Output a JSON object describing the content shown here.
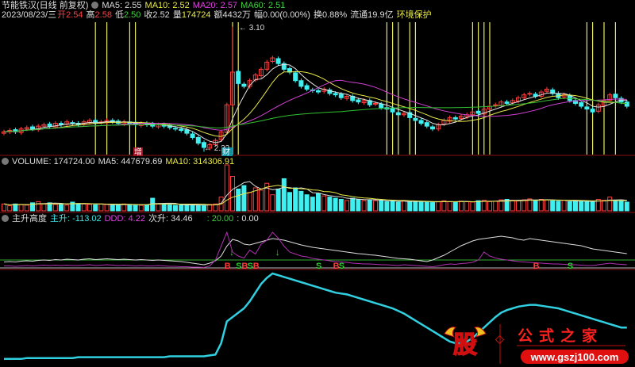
{
  "header": {
    "title": "节能铁汉(日线 前复权)",
    "ma5": "MA5: 2.55",
    "ma10": "MA10: 2.52",
    "ma20": "MA20: 2.57",
    "ma60": "MA60: 2.51",
    "date": "2023/08/23/三",
    "open_l": "开",
    "open": "2.54",
    "high_l": "高",
    "high": "2.58",
    "low_l": "低",
    "low": "2.50",
    "close": "收2.52",
    "vol_l": "量",
    "vol": "174724",
    "amount": "额4432万",
    "change": "幅0.00(0.00%)",
    "turnover": "换0.88%",
    "float": "流通19.9亿",
    "concept": "环境保护"
  },
  "volume_header": {
    "volume": "VOLUME: 174724.00",
    "ma5": "MA5: 447679.69",
    "ma10": "MA10: 314306.91"
  },
  "indicator_header": {
    "name": "主升高度",
    "zs": "主升: -113.02",
    "ddd": "DDD: 4.22",
    "cs": "次升: 34.46",
    "l20": ": 20.00",
    "l0": ": 0.00"
  },
  "labels": {
    "max": "3.10",
    "min": "2.22",
    "zeng": "增",
    "cai": "财"
  },
  "logo": {
    "char": "股",
    "name": "公式之家",
    "url": "www.gszj100.com"
  },
  "colors": {
    "up": "#ff3c3c",
    "down": "#40f0f0",
    "ma5": "#e0e0e0",
    "ma10": "#e8e84a",
    "ma20": "#d040d0",
    "ma60": "#30c030",
    "signal": "#e8e860"
  },
  "chart_data": {
    "type": "candlestick",
    "price_range": [
      2.2,
      3.12
    ],
    "closes": [
      2.36,
      2.37,
      2.36,
      2.38,
      2.39,
      2.38,
      2.4,
      2.41,
      2.4,
      2.42,
      2.41,
      2.43,
      2.42,
      2.41,
      2.43,
      2.44,
      2.42,
      2.43,
      2.44,
      2.43,
      2.42,
      2.43,
      2.42,
      2.41,
      2.42,
      2.41,
      2.4,
      2.41,
      2.4,
      2.39,
      2.38,
      2.37,
      2.35,
      2.32,
      2.28,
      2.25,
      2.27,
      2.3,
      2.36,
      2.55,
      2.78,
      2.7,
      2.68,
      2.72,
      2.76,
      2.8,
      2.85,
      2.88,
      2.84,
      2.8,
      2.78,
      2.72,
      2.68,
      2.66,
      2.65,
      2.64,
      2.66,
      2.63,
      2.62,
      2.6,
      2.61,
      2.58,
      2.57,
      2.58,
      2.55,
      2.56,
      2.53,
      2.52,
      2.5,
      2.48,
      2.49,
      2.46,
      2.44,
      2.42,
      2.4,
      2.38,
      2.41,
      2.44,
      2.46,
      2.45,
      2.47,
      2.48,
      2.5,
      2.49,
      2.52,
      2.54,
      2.55,
      2.57,
      2.56,
      2.58,
      2.6,
      2.62,
      2.63,
      2.61,
      2.64,
      2.66,
      2.63,
      2.6,
      2.62,
      2.58,
      2.56,
      2.54,
      2.52,
      2.5,
      2.55,
      2.58,
      2.62,
      2.6,
      2.57,
      2.54
    ],
    "volumes": [
      30,
      22,
      30,
      28,
      25,
      35,
      40,
      30,
      35,
      28,
      30,
      25,
      38,
      32,
      30,
      28,
      26,
      30,
      28,
      24,
      26,
      30,
      28,
      25,
      24,
      26,
      55,
      30,
      28,
      26,
      24,
      25,
      28,
      26,
      24,
      22,
      28,
      30,
      60,
      200,
      150,
      95,
      110,
      80,
      100,
      90,
      120,
      70,
      95,
      140,
      80,
      100,
      85,
      70,
      60,
      75,
      65,
      60,
      55,
      50,
      45,
      55,
      50,
      45,
      48,
      44,
      46,
      40,
      42,
      38,
      45,
      40,
      42,
      38,
      40,
      36,
      40,
      44,
      40,
      38,
      42,
      40,
      38,
      44,
      46,
      40,
      42,
      48,
      50,
      46,
      44,
      48,
      52,
      46,
      50,
      48,
      44,
      42,
      46,
      40,
      44,
      42,
      40,
      38,
      50,
      46,
      60,
      44,
      42,
      38
    ],
    "signals": [
      16,
      18,
      22,
      23,
      40,
      41,
      67,
      68,
      69,
      71,
      72,
      82,
      83,
      84,
      85,
      102,
      103,
      105,
      107
    ],
    "main_line": [
      15,
      16,
      15,
      17,
      18,
      17,
      19,
      20,
      19,
      21,
      20,
      22,
      21,
      20,
      22,
      23,
      21,
      22,
      23,
      22,
      21,
      22,
      21,
      20,
      21,
      20,
      19,
      20,
      19,
      18,
      17,
      16,
      14,
      12,
      10,
      8,
      12,
      18,
      30,
      55,
      72,
      68,
      60,
      58,
      62,
      66,
      70,
      74,
      72,
      70,
      66,
      62,
      58,
      55,
      52,
      50,
      48,
      46,
      44,
      42,
      40,
      38,
      36,
      35,
      33,
      32,
      30,
      28,
      26,
      24,
      23,
      22,
      20,
      18,
      16,
      20,
      26,
      32,
      40,
      48,
      56,
      62,
      68,
      72,
      74,
      76,
      78,
      80,
      78,
      76,
      72,
      70,
      74,
      72,
      70,
      68,
      66,
      64,
      62,
      60,
      58,
      56,
      52,
      48,
      46,
      44,
      42,
      40,
      38,
      36
    ],
    "sub_line": [
      5,
      5,
      4,
      5,
      6,
      5,
      6,
      7,
      6,
      7,
      6,
      7,
      6,
      6,
      7,
      8,
      6,
      7,
      8,
      7,
      6,
      7,
      6,
      5,
      6,
      5,
      5,
      6,
      5,
      4,
      4,
      3,
      3,
      2,
      2,
      1,
      5,
      20,
      55,
      90,
      40,
      30,
      25,
      45,
      35,
      60,
      70,
      90,
      75,
      55,
      40,
      35,
      30,
      28,
      24,
      22,
      20,
      18,
      16,
      15,
      14,
      12,
      11,
      10,
      10,
      9,
      8,
      8,
      7,
      6,
      8,
      7,
      6,
      5,
      4,
      3,
      5,
      8,
      10,
      9,
      11,
      12,
      14,
      20,
      40,
      30,
      25,
      22,
      20,
      18,
      16,
      15,
      14,
      13,
      12,
      11,
      10,
      10,
      9,
      8,
      8,
      7,
      6,
      6,
      8,
      10,
      12,
      10,
      9,
      8
    ],
    "bottom_line": [
      2,
      2,
      2,
      2,
      3,
      3,
      3,
      3,
      3,
      3,
      3,
      3,
      3,
      4,
      4,
      4,
      4,
      4,
      4,
      4,
      4,
      4,
      4,
      4,
      4,
      4,
      4,
      4,
      4,
      5,
      5,
      5,
      5,
      5,
      5,
      5,
      6,
      7,
      20,
      45,
      50,
      55,
      60,
      68,
      78,
      88,
      95,
      100,
      98,
      96,
      94,
      92,
      90,
      88,
      86,
      84,
      82,
      80,
      78,
      77,
      76,
      74,
      72,
      70,
      68,
      66,
      64,
      62,
      60,
      57,
      54,
      50,
      46,
      42,
      38,
      34,
      30,
      26,
      22,
      20,
      20,
      22,
      26,
      32,
      38,
      44,
      50,
      55,
      58,
      60,
      62,
      63,
      64,
      64,
      63,
      62,
      61,
      60,
      58,
      56,
      54,
      52,
      50,
      48,
      46,
      44,
      42,
      40,
      38,
      38
    ]
  }
}
